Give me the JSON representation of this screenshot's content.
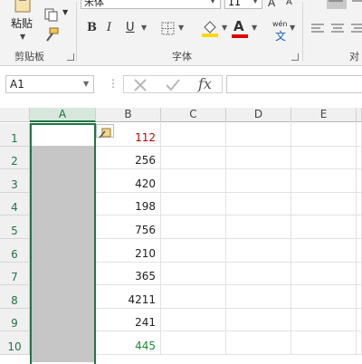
{
  "ribbon": {
    "clipboard": {
      "paste_label": "粘贴",
      "group_label": "剪贴板"
    },
    "font": {
      "font_name": "宋体",
      "font_size": "11",
      "bold": "B",
      "italic": "I",
      "underline": "U",
      "font_color_letter": "A",
      "grow_letter": "A",
      "shrink_letter": "A",
      "wen_label": "wén",
      "wen_char": "文",
      "group_label": "字体"
    },
    "align": {
      "group_label_partial": "对"
    },
    "colors": {
      "fill_color": "#ffd800",
      "font_color": "#e00000",
      "accent": "#217346"
    }
  },
  "formula_bar": {
    "name_box": "A1",
    "cancel_icon": "x-icon",
    "enter_icon": "check-icon",
    "fx_label": "fx",
    "formula_value": ""
  },
  "sheet": {
    "columns": [
      "A",
      "B",
      "C",
      "D",
      "E"
    ],
    "rows": [
      "1",
      "2",
      "3",
      "4",
      "5",
      "6",
      "7",
      "8",
      "9",
      "10"
    ],
    "column_b_values": [
      "112",
      "256",
      "420",
      "198",
      "756",
      "210",
      "365",
      "4211",
      "241",
      "445"
    ],
    "column_b_colors": [
      "#c00000",
      "#222222",
      "#222222",
      "#222222",
      "#222222",
      "#222222",
      "#222222",
      "#222222",
      "#222222",
      "#1e8a3c"
    ],
    "selected_column": "A",
    "active_cell": "A1"
  }
}
